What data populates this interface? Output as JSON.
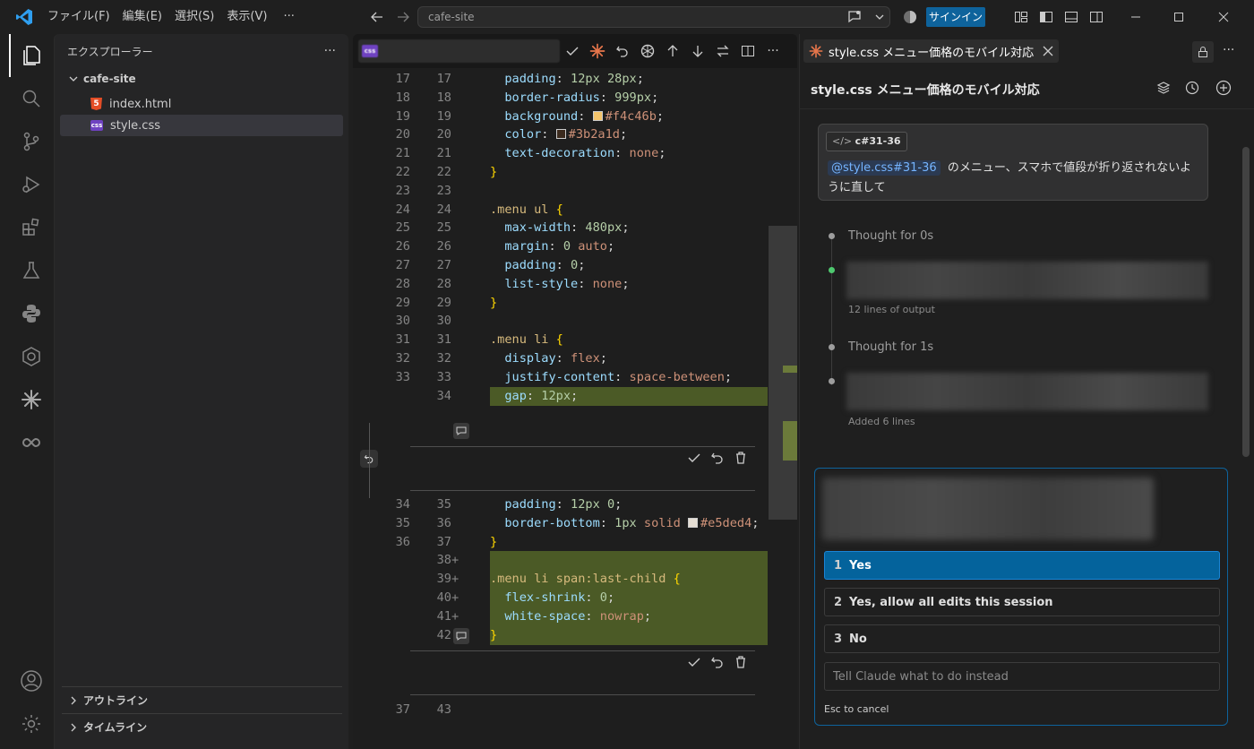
{
  "titlebar": {
    "menus": [
      "ファイル(F)",
      "編集(E)",
      "選択(S)",
      "表示(V)"
    ],
    "search": "cafe-site",
    "signin": "サインイン"
  },
  "sidebar": {
    "title": "エクスプローラー",
    "folder": "cafe-site",
    "files": [
      {
        "name": "index.html",
        "icon": "html-file-icon"
      },
      {
        "name": "style.css",
        "icon": "css-file-icon"
      }
    ],
    "outline": "アウトライン",
    "timeline": "タイムライン"
  },
  "editor": {
    "file_icon": "css",
    "lines": [
      {
        "old": "17",
        "new": "17",
        "mark": "",
        "added": false,
        "tokens": [
          [
            "k-prop",
            "  padding"
          ],
          [
            "k-w",
            ": "
          ],
          [
            "k-val",
            "12px 28px"
          ],
          [
            "k-w",
            ";"
          ]
        ]
      },
      {
        "old": "18",
        "new": "18",
        "mark": "",
        "added": false,
        "tokens": [
          [
            "k-prop",
            "  border-radius"
          ],
          [
            "k-w",
            ": "
          ],
          [
            "k-val",
            "999px"
          ],
          [
            "k-w",
            ";"
          ]
        ]
      },
      {
        "old": "19",
        "new": "19",
        "mark": "",
        "added": false,
        "tokens": [
          [
            "k-prop",
            "  background"
          ],
          [
            "k-w",
            ": "
          ],
          [
            "swatch",
            "#f4c46b"
          ],
          [
            "k-str",
            "#f4c46b"
          ],
          [
            "k-w",
            ";"
          ]
        ]
      },
      {
        "old": "20",
        "new": "20",
        "mark": "",
        "added": false,
        "tokens": [
          [
            "k-prop",
            "  color"
          ],
          [
            "k-w",
            ": "
          ],
          [
            "swatch",
            "#3b2a1d"
          ],
          [
            "k-str",
            "#3b2a1d"
          ],
          [
            "k-w",
            ";"
          ]
        ]
      },
      {
        "old": "21",
        "new": "21",
        "mark": "",
        "added": false,
        "tokens": [
          [
            "k-prop",
            "  text-decoration"
          ],
          [
            "k-w",
            ": "
          ],
          [
            "k-str",
            "none"
          ],
          [
            "k-w",
            ";"
          ]
        ]
      },
      {
        "old": "22",
        "new": "22",
        "mark": "",
        "added": false,
        "tokens": [
          [
            "k-br",
            "}"
          ]
        ]
      },
      {
        "old": "23",
        "new": "23",
        "mark": "",
        "added": false,
        "tokens": []
      },
      {
        "old": "24",
        "new": "24",
        "mark": "",
        "added": false,
        "tokens": [
          [
            "k-sel",
            ".menu ul "
          ],
          [
            "k-br",
            "{"
          ]
        ]
      },
      {
        "old": "25",
        "new": "25",
        "mark": "",
        "added": false,
        "tokens": [
          [
            "k-prop",
            "  max-width"
          ],
          [
            "k-w",
            ": "
          ],
          [
            "k-val",
            "480px"
          ],
          [
            "k-w",
            ";"
          ]
        ]
      },
      {
        "old": "26",
        "new": "26",
        "mark": "",
        "added": false,
        "tokens": [
          [
            "k-prop",
            "  margin"
          ],
          [
            "k-w",
            ": "
          ],
          [
            "k-val",
            "0 "
          ],
          [
            "k-str",
            "auto"
          ],
          [
            "k-w",
            ";"
          ]
        ]
      },
      {
        "old": "27",
        "new": "27",
        "mark": "",
        "added": false,
        "tokens": [
          [
            "k-prop",
            "  padding"
          ],
          [
            "k-w",
            ": "
          ],
          [
            "k-val",
            "0"
          ],
          [
            "k-w",
            ";"
          ]
        ]
      },
      {
        "old": "28",
        "new": "28",
        "mark": "",
        "added": false,
        "tokens": [
          [
            "k-prop",
            "  list-style"
          ],
          [
            "k-w",
            ": "
          ],
          [
            "k-str",
            "none"
          ],
          [
            "k-w",
            ";"
          ]
        ]
      },
      {
        "old": "29",
        "new": "29",
        "mark": "",
        "added": false,
        "tokens": [
          [
            "k-br",
            "}"
          ]
        ]
      },
      {
        "old": "30",
        "new": "30",
        "mark": "",
        "added": false,
        "tokens": []
      },
      {
        "old": "31",
        "new": "31",
        "mark": "",
        "added": false,
        "tokens": [
          [
            "k-sel",
            ".menu li "
          ],
          [
            "k-br",
            "{"
          ]
        ]
      },
      {
        "old": "32",
        "new": "32",
        "mark": "",
        "added": false,
        "tokens": [
          [
            "k-prop",
            "  display"
          ],
          [
            "k-w",
            ": "
          ],
          [
            "k-str",
            "flex"
          ],
          [
            "k-w",
            ";"
          ]
        ]
      },
      {
        "old": "33",
        "new": "33",
        "mark": "",
        "added": false,
        "tokens": [
          [
            "k-prop",
            "  justify-content"
          ],
          [
            "k-w",
            ": "
          ],
          [
            "k-str",
            "space-between"
          ],
          [
            "k-w",
            ";"
          ]
        ]
      },
      {
        "old": "",
        "new": "34",
        "mark": "",
        "added": true,
        "tokens": [
          [
            "k-prop",
            "  gap"
          ],
          [
            "k-w",
            ": "
          ],
          [
            "k-val",
            "12px"
          ],
          [
            "k-w",
            ";"
          ]
        ]
      }
    ],
    "lines2": [
      {
        "old": "34",
        "new": "35",
        "mark": "",
        "added": false,
        "tokens": [
          [
            "k-prop",
            "  padding"
          ],
          [
            "k-w",
            ": "
          ],
          [
            "k-val",
            "12px 0"
          ],
          [
            "k-w",
            ";"
          ]
        ]
      },
      {
        "old": "35",
        "new": "36",
        "mark": "",
        "added": false,
        "tokens": [
          [
            "k-prop",
            "  border-bottom"
          ],
          [
            "k-w",
            ": "
          ],
          [
            "k-val",
            "1px "
          ],
          [
            "k-str",
            "solid "
          ],
          [
            "swatch",
            "#e5ded4"
          ],
          [
            "k-str",
            "#e5ded4"
          ],
          [
            "k-w",
            ";"
          ]
        ]
      },
      {
        "old": "36",
        "new": "37",
        "mark": "",
        "added": false,
        "tokens": [
          [
            "k-br",
            "}"
          ]
        ]
      },
      {
        "old": "",
        "new": "38",
        "mark": "+",
        "added": true,
        "tokens": []
      },
      {
        "old": "",
        "new": "39",
        "mark": "+",
        "added": true,
        "tokens": [
          [
            "k-sel",
            ".menu li span:last-child "
          ],
          [
            "k-br",
            "{"
          ]
        ]
      },
      {
        "old": "",
        "new": "40",
        "mark": "+",
        "added": true,
        "tokens": [
          [
            "k-prop",
            "  flex-shrink"
          ],
          [
            "k-w",
            ": "
          ],
          [
            "k-val",
            "0"
          ],
          [
            "k-w",
            ";"
          ]
        ]
      },
      {
        "old": "",
        "new": "41",
        "mark": "+",
        "added": true,
        "tokens": [
          [
            "k-prop",
            "  white-space"
          ],
          [
            "k-w",
            ": "
          ],
          [
            "k-str",
            "nowrap"
          ],
          [
            "k-w",
            ";"
          ]
        ]
      },
      {
        "old": "",
        "new": "42",
        "mark": "",
        "added": true,
        "tokens": [
          [
            "k-br",
            "}"
          ]
        ]
      }
    ],
    "lines3": [
      {
        "old": "37",
        "new": "43",
        "mark": "",
        "added": false,
        "tokens": []
      }
    ]
  },
  "chat": {
    "tab_title": "style.css メニュー価格のモバイル対応",
    "header": "style.css メニュー価格のモバイル対応",
    "chip": "c#31-36",
    "mention": "@style.css#31-36",
    "message": "のメニュー、スマホで値段が折り返されないように直して",
    "steps": [
      {
        "label": "Thought for 0s"
      },
      {
        "sub": "12 lines of output"
      },
      {
        "label": "Thought for 1s"
      },
      {
        "sub": "Added 6 lines"
      }
    ],
    "options": [
      {
        "num": "1",
        "label": "Yes"
      },
      {
        "num": "2",
        "label": "Yes, allow all edits this session"
      },
      {
        "num": "3",
        "label": "No"
      }
    ],
    "input_placeholder": "Tell Claude what to do instead",
    "cancel_hint": "Esc to cancel"
  }
}
